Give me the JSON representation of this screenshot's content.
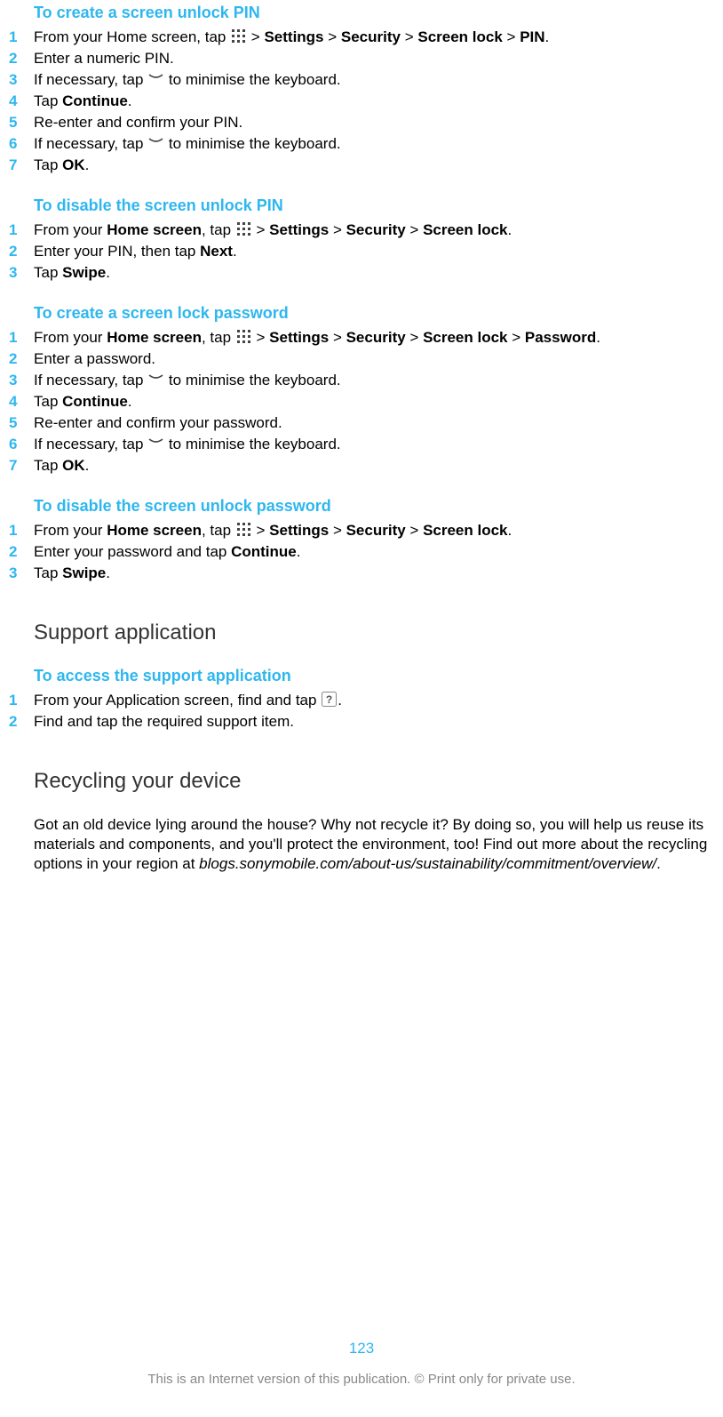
{
  "sections": [
    {
      "title": "To create a screen unlock PIN",
      "gap": false,
      "steps": [
        {
          "n": "1",
          "segs": [
            {
              "t": "From your Home screen, tap "
            },
            {
              "icon": "apps"
            },
            {
              "t": " > "
            },
            {
              "b": "Settings"
            },
            {
              "t": " > "
            },
            {
              "b": "Security"
            },
            {
              "t": " > "
            },
            {
              "b": "Screen lock"
            },
            {
              "t": " > "
            },
            {
              "b": "PIN"
            },
            {
              "t": "."
            }
          ]
        },
        {
          "n": "2",
          "segs": [
            {
              "t": "Enter a numeric PIN."
            }
          ]
        },
        {
          "n": "3",
          "segs": [
            {
              "t": "If necessary, tap "
            },
            {
              "icon": "down"
            },
            {
              "t": " to minimise the keyboard."
            }
          ]
        },
        {
          "n": "4",
          "segs": [
            {
              "t": "Tap "
            },
            {
              "b": "Continue"
            },
            {
              "t": "."
            }
          ]
        },
        {
          "n": "5",
          "segs": [
            {
              "t": "Re-enter and confirm your PIN."
            }
          ]
        },
        {
          "n": "6",
          "segs": [
            {
              "t": "If necessary, tap "
            },
            {
              "icon": "down"
            },
            {
              "t": " to minimise the keyboard."
            }
          ]
        },
        {
          "n": "7",
          "segs": [
            {
              "t": "Tap "
            },
            {
              "b": "OK"
            },
            {
              "t": "."
            }
          ]
        }
      ]
    },
    {
      "title": "To disable the screen unlock PIN",
      "gap": true,
      "steps": [
        {
          "n": "1",
          "segs": [
            {
              "t": "From your "
            },
            {
              "b": "Home screen"
            },
            {
              "t": ", tap "
            },
            {
              "icon": "apps"
            },
            {
              "t": " > "
            },
            {
              "b": "Settings"
            },
            {
              "t": " > "
            },
            {
              "b": "Security"
            },
            {
              "t": " > "
            },
            {
              "b": "Screen lock"
            },
            {
              "t": "."
            }
          ]
        },
        {
          "n": "2",
          "segs": [
            {
              "t": "Enter your PIN, then tap "
            },
            {
              "b": "Next"
            },
            {
              "t": "."
            }
          ]
        },
        {
          "n": "3",
          "segs": [
            {
              "t": "Tap "
            },
            {
              "b": "Swipe"
            },
            {
              "t": "."
            }
          ]
        }
      ]
    },
    {
      "title": "To create a screen lock password",
      "gap": true,
      "steps": [
        {
          "n": "1",
          "segs": [
            {
              "t": "From your "
            },
            {
              "b": "Home screen"
            },
            {
              "t": ", tap "
            },
            {
              "icon": "apps"
            },
            {
              "t": " > "
            },
            {
              "b": "Settings"
            },
            {
              "t": " > "
            },
            {
              "b": "Security"
            },
            {
              "t": " > "
            },
            {
              "b": "Screen lock"
            },
            {
              "t": " > "
            },
            {
              "b": "Password"
            },
            {
              "t": "."
            }
          ]
        },
        {
          "n": "2",
          "segs": [
            {
              "t": "Enter a password."
            }
          ]
        },
        {
          "n": "3",
          "segs": [
            {
              "t": "If necessary, tap "
            },
            {
              "icon": "down"
            },
            {
              "t": " to minimise the keyboard."
            }
          ]
        },
        {
          "n": "4",
          "segs": [
            {
              "t": "Tap "
            },
            {
              "b": "Continue"
            },
            {
              "t": "."
            }
          ]
        },
        {
          "n": "5",
          "segs": [
            {
              "t": "Re-enter and confirm your password."
            }
          ]
        },
        {
          "n": "6",
          "segs": [
            {
              "t": "If necessary, tap "
            },
            {
              "icon": "down"
            },
            {
              "t": " to minimise the keyboard."
            }
          ]
        },
        {
          "n": "7",
          "segs": [
            {
              "t": "Tap "
            },
            {
              "b": "OK"
            },
            {
              "t": "."
            }
          ]
        }
      ]
    },
    {
      "title": "To disable the screen unlock password",
      "gap": true,
      "steps": [
        {
          "n": "1",
          "segs": [
            {
              "t": "From your "
            },
            {
              "b": "Home screen"
            },
            {
              "t": ", tap "
            },
            {
              "icon": "apps"
            },
            {
              "t": " > "
            },
            {
              "b": "Settings"
            },
            {
              "t": " > "
            },
            {
              "b": "Security"
            },
            {
              "t": " > "
            },
            {
              "b": "Screen lock"
            },
            {
              "t": "."
            }
          ]
        },
        {
          "n": "2",
          "segs": [
            {
              "t": "Enter your password and tap "
            },
            {
              "b": "Continue"
            },
            {
              "t": "."
            }
          ]
        },
        {
          "n": "3",
          "segs": [
            {
              "t": "Tap "
            },
            {
              "b": "Swipe"
            },
            {
              "t": "."
            }
          ]
        }
      ]
    }
  ],
  "blocks": [
    {
      "heading": "Support application",
      "title": "To access the support application",
      "steps": [
        {
          "n": "1",
          "segs": [
            {
              "t": "From your Application screen, find and tap "
            },
            {
              "icon": "support"
            },
            {
              "t": "."
            }
          ]
        },
        {
          "n": "2",
          "segs": [
            {
              "t": "Find and tap the required support item."
            }
          ]
        }
      ]
    },
    {
      "heading": "Recycling your device",
      "para": [
        {
          "t": "Got an old device lying around the house? Why not recycle it? By doing so, you will help us reuse its materials and components, and you'll protect the environment, too! Find out more about the recycling options in your region at "
        },
        {
          "i": "blogs.sonymobile.com/about-us/sustainability/commitment/overview/"
        },
        {
          "t": "."
        }
      ]
    }
  ],
  "footer": {
    "page": "123",
    "note": "This is an Internet version of this publication. © Print only for private use."
  }
}
